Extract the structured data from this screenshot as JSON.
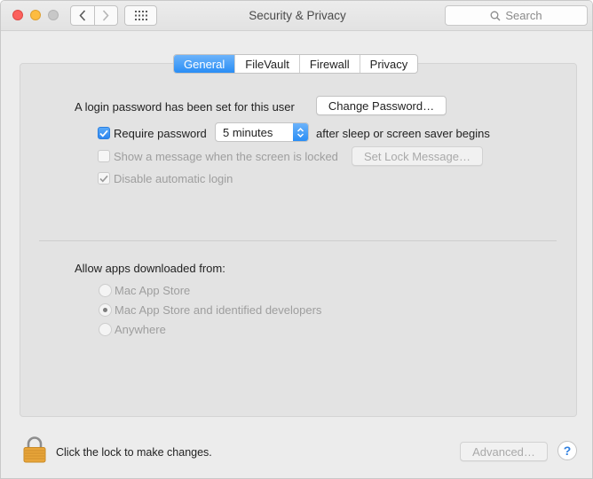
{
  "window": {
    "title": "Security & Privacy",
    "search_placeholder": "Search"
  },
  "tabs": [
    {
      "label": "General",
      "active": true
    },
    {
      "label": "FileVault",
      "active": false
    },
    {
      "label": "Firewall",
      "active": false
    },
    {
      "label": "Privacy",
      "active": false
    }
  ],
  "general": {
    "login_password_text": "A login password has been set for this user",
    "change_password_label": "Change Password…",
    "require_password": {
      "label": "Require password",
      "checked": true,
      "delay_value": "5 minutes",
      "suffix": "after sleep or screen saver begins"
    },
    "show_message": {
      "label": "Show a message when the screen is locked",
      "checked": false,
      "enabled": false,
      "button_label": "Set Lock Message…"
    },
    "disable_auto_login": {
      "label": "Disable automatic login",
      "checked": true,
      "enabled": false
    },
    "allow_apps": {
      "heading": "Allow apps downloaded from:",
      "options": [
        {
          "label": "Mac App Store",
          "selected": false
        },
        {
          "label": "Mac App Store and identified developers",
          "selected": true
        },
        {
          "label": "Anywhere",
          "selected": false
        }
      ]
    }
  },
  "footer": {
    "lock_text": "Click the lock to make changes.",
    "advanced_label": "Advanced…",
    "help_label": "?"
  },
  "colors": {
    "accent": "#2a8ef5",
    "lock": "#e8a53a"
  },
  "icons": {
    "back": "chevron-left-icon",
    "forward": "chevron-right-icon",
    "show_all": "grid-icon",
    "search": "search-icon",
    "lock": "lock-icon",
    "checkmark": "checkmark-icon",
    "stepper": "up-down-arrows-icon"
  }
}
